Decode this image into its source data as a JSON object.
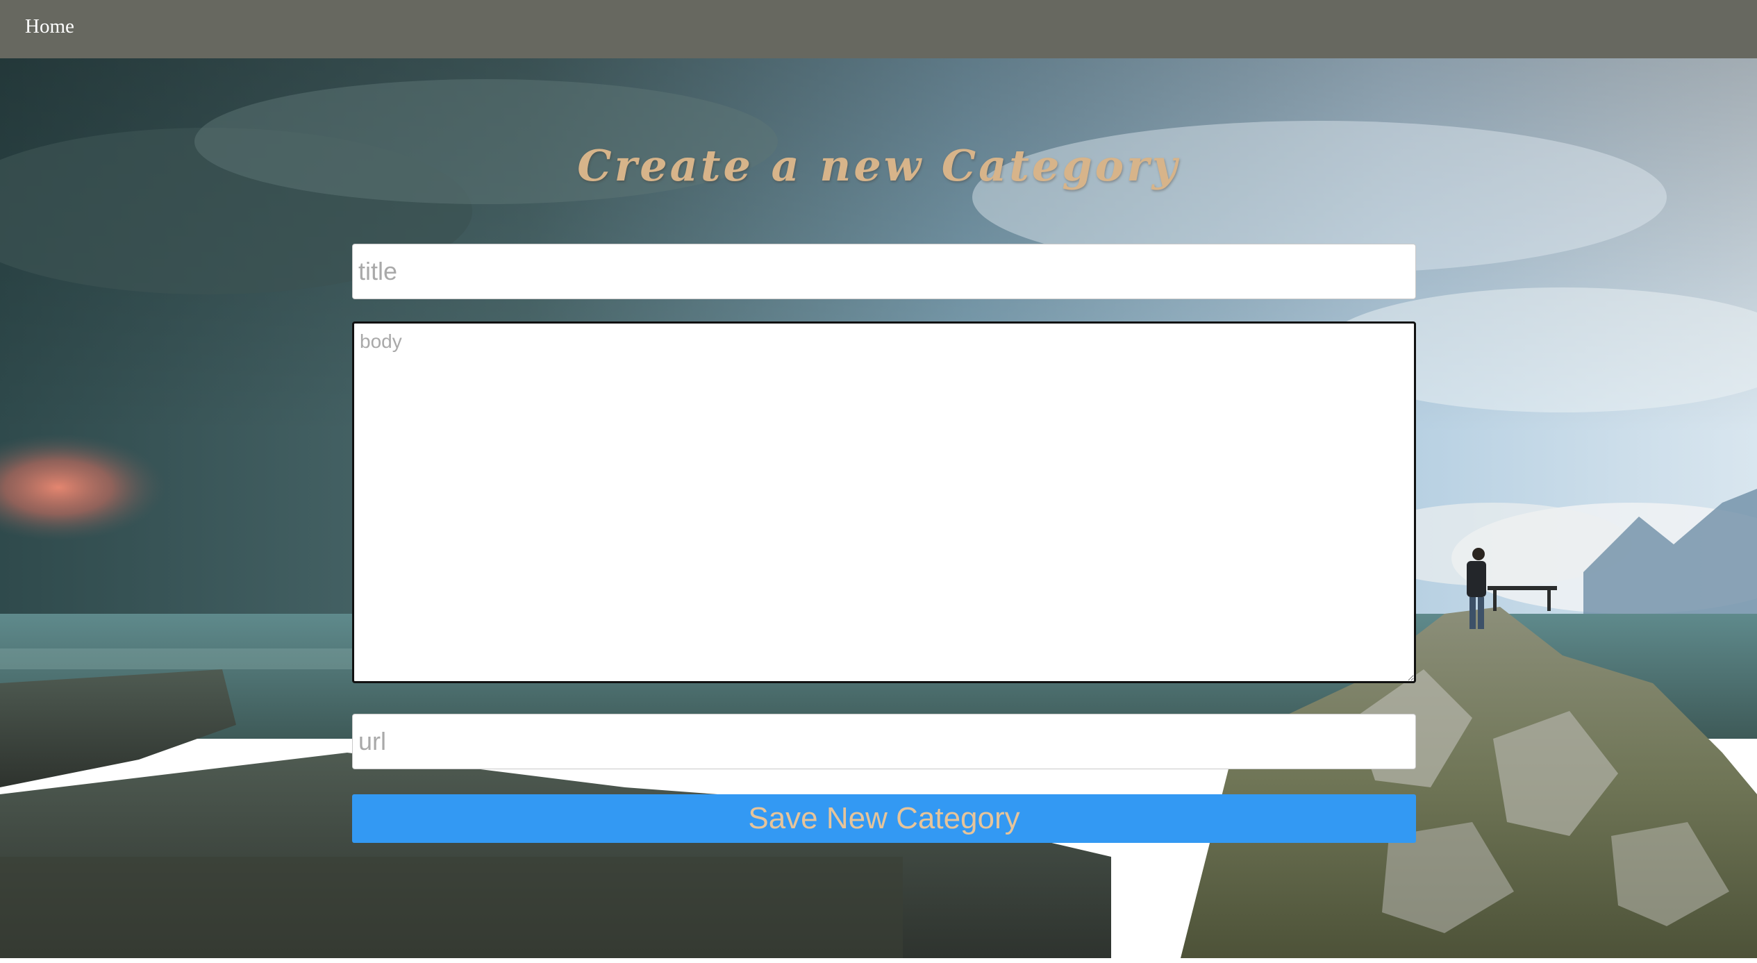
{
  "nav": {
    "home_label": "Home"
  },
  "page": {
    "title": "Create a new Category"
  },
  "form": {
    "title_placeholder": "title",
    "title_value": "",
    "body_placeholder": "body",
    "body_value": "",
    "url_placeholder": "url",
    "url_value": "",
    "submit_label": "Save New Category"
  },
  "colors": {
    "navbar_bg": "#676860",
    "title_color": "#d7b48a",
    "button_bg": "#3399f3",
    "button_text": "#e6c49a"
  },
  "background": {
    "description_icon": "landscape-photo"
  }
}
